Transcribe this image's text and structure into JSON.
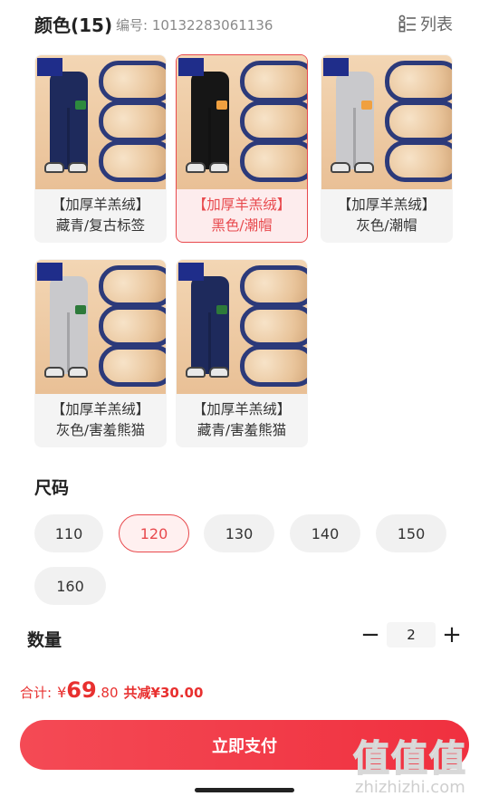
{
  "color_section": {
    "title": "颜色(15)",
    "sku_code": "编号: 10132283061136",
    "view_toggle_label": "列表",
    "variants": [
      {
        "line1": "【加厚羊羔绒】",
        "line2": "藏青/复古标签",
        "pant_color": "#1e2a5c",
        "patch_color": "#2d8a3e",
        "selected": false
      },
      {
        "line1": "【加厚羊羔绒】",
        "line2": "黑色/潮帽",
        "pant_color": "#161616",
        "patch_color": "#f0a040",
        "selected": true
      },
      {
        "line1": "【加厚羊羔绒】",
        "line2": "灰色/潮帽",
        "pant_color": "#c9c9cc",
        "patch_color": "#f0a040",
        "selected": false
      },
      {
        "line1": "【加厚羊羔绒】",
        "line2": "灰色/害羞熊猫",
        "pant_color": "#c9c9cc",
        "patch_color": "#2d7a3a",
        "selected": false
      },
      {
        "line1": "【加厚羊羔绒】",
        "line2": "藏青/害羞熊猫",
        "pant_color": "#1e2a5c",
        "patch_color": "#2d7a3a",
        "selected": false
      }
    ]
  },
  "size_section": {
    "title": "尺码",
    "options": [
      "110",
      "120",
      "130",
      "140",
      "150",
      "160"
    ],
    "selected": "120"
  },
  "quantity_section": {
    "title": "数量",
    "minus": "−",
    "value": "2",
    "plus": "+"
  },
  "summary": {
    "total_label": "合计:",
    "currency": "¥",
    "price_integer": "69",
    "price_decimal": ".80",
    "discount_text": "共减¥30.00"
  },
  "pay_button_label": "立即支付",
  "watermark": {
    "glyphs": "值值值",
    "url": "zhizhizhi.com"
  },
  "colors": {
    "accent": "#e8494d",
    "price": "#e8302f",
    "button": "#f23a48"
  }
}
